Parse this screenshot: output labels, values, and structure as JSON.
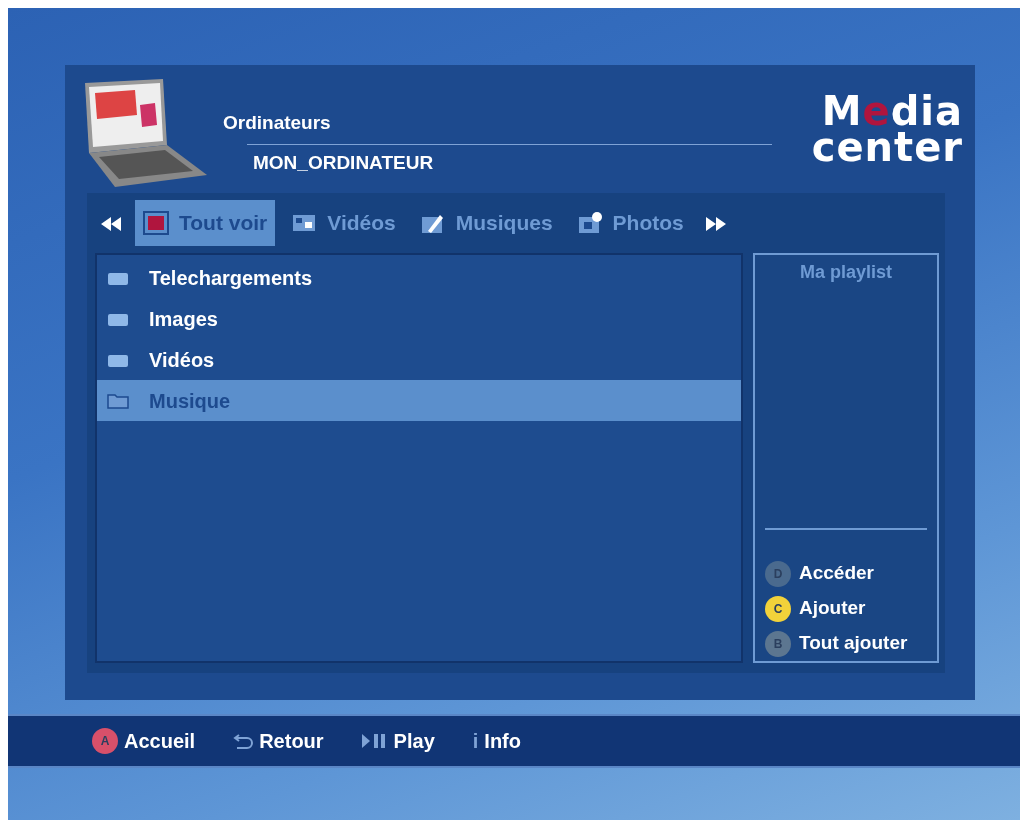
{
  "header": {
    "category": "Ordinateurs",
    "device": "MON_ORDINATEUR"
  },
  "logo": {
    "start": "M",
    "accent": "e",
    "end": "dia",
    "line2": "center"
  },
  "tabs": [
    {
      "label": "Tout voir",
      "kind": "all",
      "selected": true
    },
    {
      "label": "Vidéos",
      "kind": "video",
      "selected": false
    },
    {
      "label": "Musiques",
      "kind": "music",
      "selected": false
    },
    {
      "label": "Photos",
      "kind": "photo",
      "selected": false
    }
  ],
  "folders": [
    {
      "label": "Telechargements",
      "selected": false
    },
    {
      "label": "Images",
      "selected": false
    },
    {
      "label": "Vidéos",
      "selected": false
    },
    {
      "label": "Musique",
      "selected": true
    }
  ],
  "playlist": {
    "title": "Ma playlist",
    "actions": [
      {
        "key": "D",
        "label": "Accéder",
        "color": "#4a6a8e"
      },
      {
        "key": "C",
        "label": "Ajouter",
        "color": "#f2d23a"
      },
      {
        "key": "B",
        "label": "Tout ajouter",
        "color": "#5c7690"
      }
    ]
  },
  "footer": [
    {
      "kind": "key",
      "key": "A",
      "color": "#d8506a",
      "label": "Accueil"
    },
    {
      "kind": "back",
      "label": "Retour"
    },
    {
      "kind": "play",
      "label": "Play"
    },
    {
      "kind": "info",
      "icon": "i",
      "label": "Info"
    }
  ]
}
